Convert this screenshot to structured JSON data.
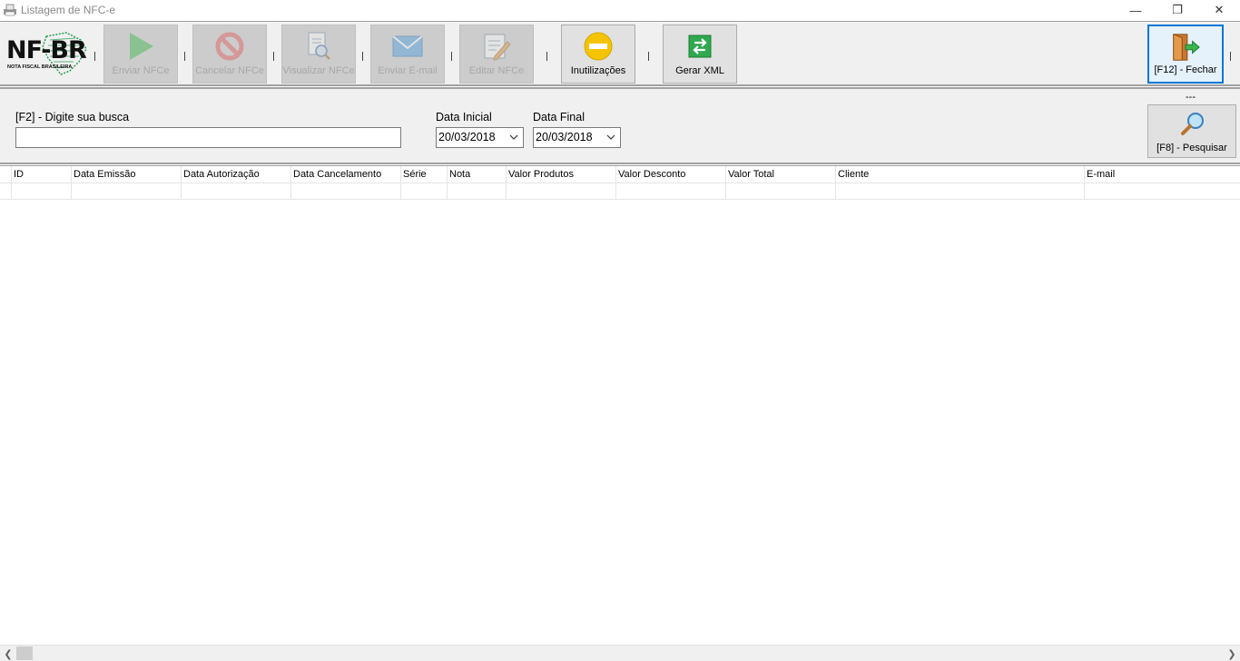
{
  "window": {
    "title": "Listagem de NFC-e",
    "controls": {
      "minimize": "—",
      "maximize": "❐",
      "close": "✕"
    }
  },
  "logo": {
    "text": "NF-BR",
    "subtitle": "NOTA FISCAL BRASILEIRA"
  },
  "toolbar": {
    "buttons": [
      {
        "label": "Enviar NFCe",
        "icon": "play-icon",
        "enabled": false
      },
      {
        "label": "Cancelar NFCe",
        "icon": "cancel-icon",
        "enabled": false
      },
      {
        "label": "Visualizar NFCe",
        "icon": "view-document-icon",
        "enabled": false
      },
      {
        "label": "Enviar E-mail",
        "icon": "mail-icon",
        "enabled": false
      },
      {
        "label": "Editar NFCe",
        "icon": "edit-document-icon",
        "enabled": false
      },
      {
        "label": "Inutilizações",
        "icon": "minus-circle-icon",
        "enabled": true
      },
      {
        "label": "Gerar XML",
        "icon": "exchange-icon",
        "enabled": true
      }
    ],
    "close_button": {
      "label": "[F12] - Fechar",
      "icon": "exit-door-icon"
    }
  },
  "search": {
    "label": "[F2] - Digite sua busca",
    "value": "",
    "date_start_label": "Data Inicial",
    "date_start_value": "20/03/2018",
    "date_end_label": "Data Final",
    "date_end_value": "20/03/2018",
    "dash_text": "---",
    "search_button_label": "[F8] - Pesquisar"
  },
  "grid": {
    "columns": [
      "ID",
      "Data Emissão",
      "Data Autorização",
      "Data Cancelamento",
      "Série",
      "Nota",
      "Valor Produtos",
      "Valor Desconto",
      "Valor Total",
      "Cliente",
      "E-mail"
    ],
    "rows": []
  },
  "colors": {
    "panel_bg": "#f0f0f0",
    "focus_border": "#0078d7",
    "play_green": "#3cb44b",
    "cancel_red": "#e05a5a",
    "yellow": "#f5c400"
  }
}
